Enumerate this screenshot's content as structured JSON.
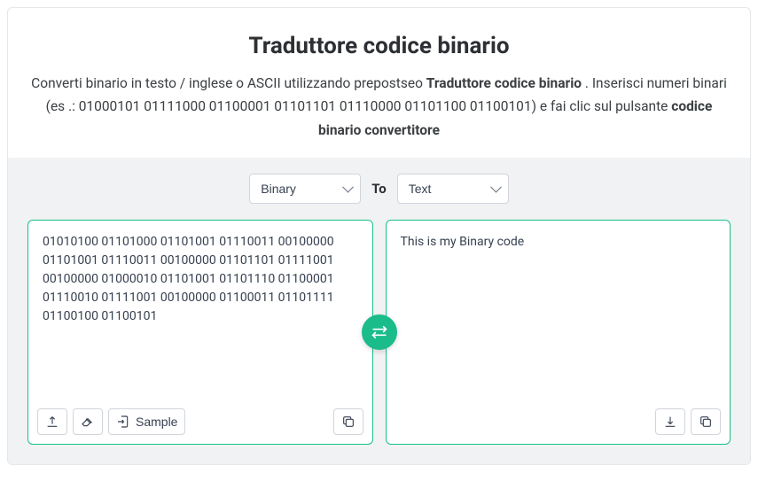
{
  "header": {
    "title": "Traduttore codice binario",
    "subtitle_pre": "Converti binario in testo / inglese o ASCII utilizzando prepostseo ",
    "subtitle_bold1": "Traduttore codice binario",
    "subtitle_mid": " . Inserisci numeri binari (es .: 01000101 01111000 01100001 01101101 01110000 01101100 01100101) e fai clic sul pulsante ",
    "subtitle_bold2": "codice binario convertitore"
  },
  "selectors": {
    "from_value": "Binary",
    "to_label": "To",
    "to_value": "Text"
  },
  "panes": {
    "input_value": "01010100 01101000 01101001 01110011 00100000 01101001 01110011 00100000 01101101 01111001 00100000 01000010 01101001 01101110 01100001 01110010 01111001 00100000 01100011 01101111 01100100 01100101",
    "output_value": "This is my Binary code",
    "sample_label": "Sample"
  }
}
